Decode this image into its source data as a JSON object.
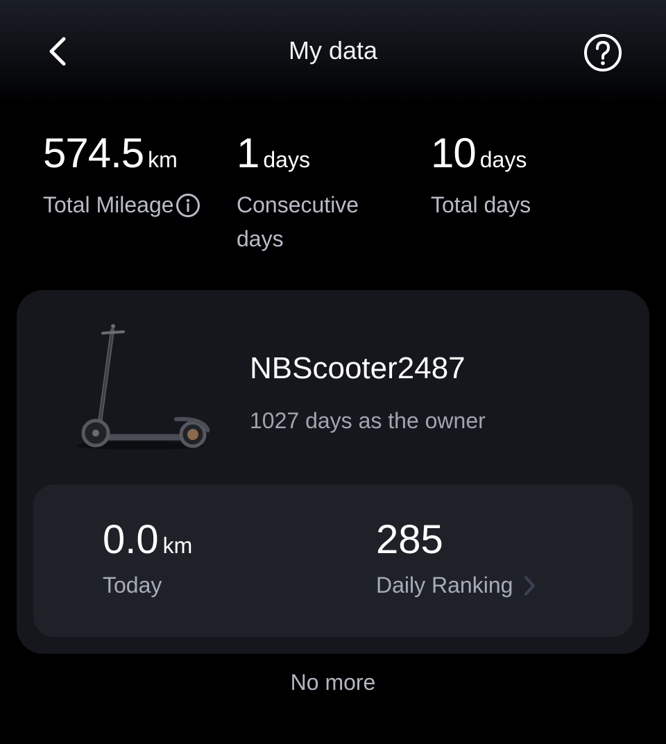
{
  "header": {
    "title": "My data",
    "back_icon": "chevron-left-icon",
    "help_icon": "question-circle-icon"
  },
  "stats": [
    {
      "value": "574.5",
      "unit": "km",
      "label": "Total Mileage",
      "info_icon": "info-circle-icon"
    },
    {
      "value": "1",
      "unit": "days",
      "label": "Consecutive days"
    },
    {
      "value": "10",
      "unit": "days",
      "label": "Total days"
    }
  ],
  "device": {
    "image": "scooter-image",
    "name": "NBScooter2487",
    "ownership": "1027 days as the owner"
  },
  "today": {
    "value": "0.0",
    "unit": "km",
    "label": "Today"
  },
  "ranking": {
    "value": "285",
    "label": "Daily Ranking",
    "icon": "chevron-right-icon"
  },
  "footer": {
    "text": "No more"
  },
  "colors": {
    "background": "#000000",
    "card": "#15171c",
    "inner_card": "#1e2128",
    "primary_text": "#ffffff",
    "secondary_text": "#b8bcc6",
    "chevron": "#3a4152"
  }
}
